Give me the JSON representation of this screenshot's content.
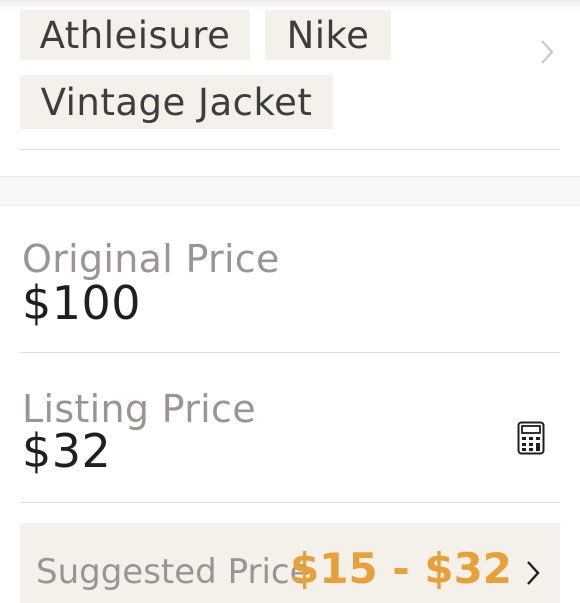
{
  "tags": [
    "Athleisure",
    "Nike",
    "Vintage Jacket"
  ],
  "original_price": {
    "label": "Original Price",
    "value": "$100"
  },
  "listing_price": {
    "label": "Listing Price",
    "value": "$32"
  },
  "suggested_price": {
    "label": "Suggested Price",
    "range": "$15 - $32"
  },
  "colors": {
    "tag_bg": "#f4f0ea",
    "accent": "#e8a13a",
    "label": "#9a9590"
  },
  "icons": [
    "chevron-right-icon",
    "calculator-icon"
  ]
}
